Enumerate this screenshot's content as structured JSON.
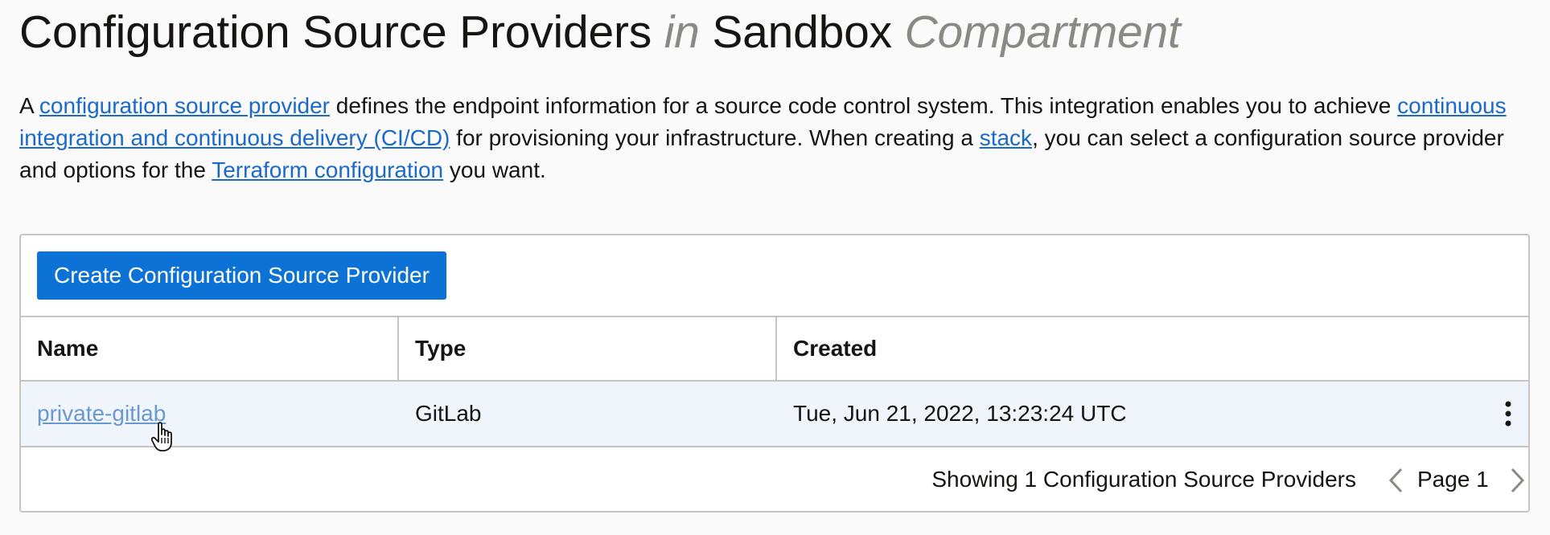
{
  "page": {
    "title_part1": "Configuration Source Providers",
    "title_in": "in",
    "title_part2": "Sandbox",
    "title_compartment": "Compartment"
  },
  "description": {
    "text1": "A ",
    "link1": "configuration source provider",
    "text2": " defines the endpoint information for a source code control system. This integration enables you to achieve ",
    "link2": "continuous integration and continuous delivery (CI/CD)",
    "text3": " for provisioning your infrastructure. When creating a ",
    "link3": "stack",
    "text4": ", you can select a configuration source provider and options for the ",
    "link4": "Terraform configuration",
    "text5": " you want."
  },
  "toolbar": {
    "create_label": "Create Configuration Source Provider"
  },
  "table": {
    "headers": [
      "Name",
      "Type",
      "Created"
    ],
    "rows": [
      {
        "name": "private-gitlab",
        "type": "GitLab",
        "created": "Tue, Jun 21, 2022, 13:23:24 UTC"
      }
    ]
  },
  "footer": {
    "showing": "Showing 1 Configuration Source Providers",
    "page_label": "Page 1"
  },
  "icons": {
    "row_actions": "kebab-menu-icon",
    "prev": "chevron-left-icon",
    "next": "chevron-right-icon",
    "cursor": "hand-pointer-cursor-icon"
  },
  "colors": {
    "link": "#1b6ac9",
    "visited_link": "#6a99cf",
    "primary_button": "#0d72d6",
    "row_highlight": "#f0f5fb",
    "border": "#c6c5c3"
  }
}
